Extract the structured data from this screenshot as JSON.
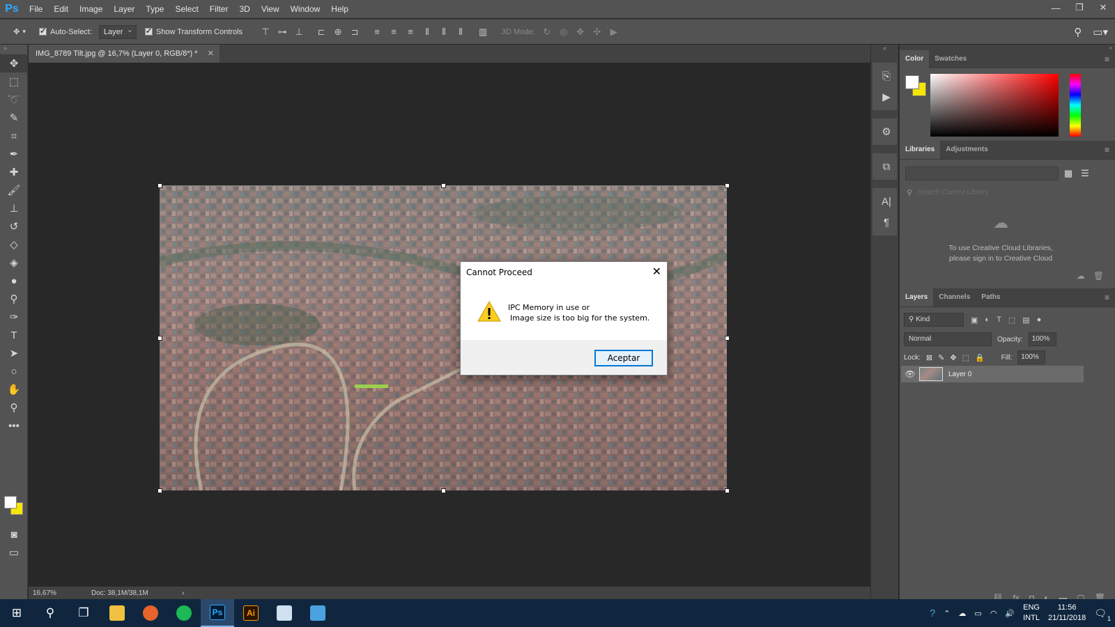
{
  "app": {
    "logo": "Ps"
  },
  "menu": [
    "File",
    "Edit",
    "Image",
    "Layer",
    "Type",
    "Select",
    "Filter",
    "3D",
    "View",
    "Window",
    "Help"
  ],
  "window_controls": {
    "minimize": "—",
    "restore": "❐",
    "close": "✕"
  },
  "options": {
    "auto_select_label": "Auto-Select:",
    "auto_select_value": "Layer",
    "show_transform_label": "Show Transform Controls",
    "mode_3d_label": "3D Mode:"
  },
  "document": {
    "tab_title": "IMG_8789 Tilt.jpg @ 16,7% (Layer 0, RGB/8*) *",
    "zoom": "16,67%",
    "doc_size": "Doc: 38,1M/38,1M"
  },
  "panels": {
    "color_tabs": [
      "Color",
      "Swatches"
    ],
    "libraries_tabs": [
      "Libraries",
      "Adjustments"
    ],
    "libraries_search_placeholder": "Search Current Library",
    "libraries_message_line1": "To use Creative Cloud Libraries,",
    "libraries_message_line2": "please sign in to Creative Cloud",
    "layers_tabs": [
      "Layers",
      "Channels",
      "Paths"
    ],
    "kind_label": "Kind",
    "blend_mode": "Normal",
    "opacity_label": "Opacity:",
    "opacity_value": "100%",
    "lock_label": "Lock:",
    "fill_label": "Fill:",
    "fill_value": "100%",
    "layer_name": "Layer 0"
  },
  "dialog": {
    "title": "Cannot Proceed",
    "message_line1": "IPC Memory in use or",
    "message_line2": "Image size is too big for the system.",
    "button": "Aceptar"
  },
  "taskbar": {
    "lang_line1": "ENG",
    "lang_line2": "INTL",
    "time": "11:56",
    "date": "21/11/2018",
    "notification_count": "1"
  },
  "colors": {
    "foreground": "#ffffff",
    "background": "#f7e600",
    "accent": "#0078d7"
  }
}
